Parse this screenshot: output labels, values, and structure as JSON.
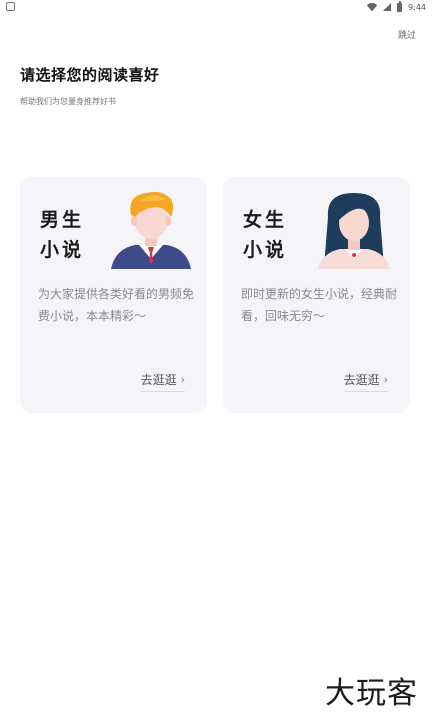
{
  "status_bar": {
    "time": "9:44"
  },
  "header": {
    "skip_label": "跳过",
    "title": "请选择您的阅读喜好",
    "subtitle": "帮助我们为您量身推荐好书"
  },
  "cards": [
    {
      "title_line1": "男生",
      "title_line2": "小说",
      "description": "为大家提供各类好看的男频免费小说，本本精彩～",
      "link_label": "去逛逛",
      "illustration": "male-avatar-illustration"
    },
    {
      "title_line1": "女生",
      "title_line2": "小说",
      "description": "即时更新的女生小说，经典耐看，回味无穷～",
      "link_label": "去逛逛",
      "illustration": "female-avatar-illustration"
    }
  ],
  "watermark": "大玩客",
  "colors": {
    "card_background": "#f4f4f9",
    "male_hair": "#f5a623",
    "male_suit": "#3f4a8a",
    "female_hair": "#1e3d5c",
    "tie": "#e0314a"
  }
}
